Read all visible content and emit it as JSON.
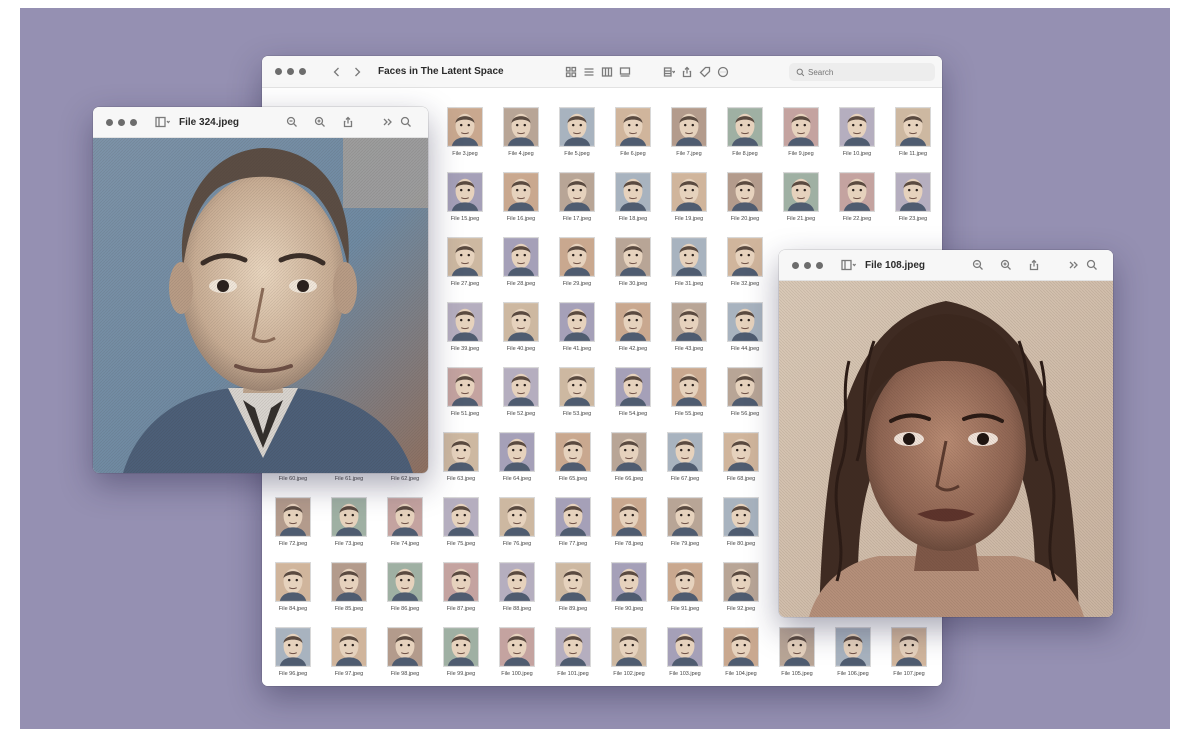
{
  "finder": {
    "title": "Faces in The Latent Space",
    "search_placeholder": "Search",
    "files": [
      "File 3.jpeg",
      "File 4.jpeg",
      "File 5.jpeg",
      "File 6.jpeg",
      "File 7.jpeg",
      "File 8.jpeg",
      "File 9.jpeg",
      "File 10.jpeg",
      "File 11.jpeg",
      "File 15.jpeg",
      "File 16.jpeg",
      "File 17.jpeg",
      "File 18.jpeg",
      "File 19.jpeg",
      "File 20.jpeg",
      "File 21.jpeg",
      "File 22.jpeg",
      "File 23.jpeg",
      "File 27.jpeg",
      "File 28.jpeg",
      "File 29.jpeg",
      "File 30.jpeg",
      "File 31.jpeg",
      "File 32.jpeg",
      "",
      "",
      "",
      "File 39.jpeg",
      "File 40.jpeg",
      "File 41.jpeg",
      "File 42.jpeg",
      "File 43.jpeg",
      "File 44.jpeg",
      "",
      "",
      "",
      "File 51.jpeg",
      "File 52.jpeg",
      "File 53.jpeg",
      "File 54.jpeg",
      "File 55.jpeg",
      "File 56.jpeg",
      "",
      "",
      "",
      "File 60.jpeg",
      "File 61.jpeg",
      "File 62.jpeg",
      "File 63.jpeg",
      "File 64.jpeg",
      "File 65.jpeg",
      "File 66.jpeg",
      "File 67.jpeg",
      "File 68.jpeg",
      "File 72.jpeg",
      "File 73.jpeg",
      "File 74.jpeg",
      "File 75.jpeg",
      "File 76.jpeg",
      "File 77.jpeg",
      "File 78.jpeg",
      "File 79.jpeg",
      "File 80.jpeg",
      "File 84.jpeg",
      "File 85.jpeg",
      "File 86.jpeg",
      "File 87.jpeg",
      "File 88.jpeg",
      "File 89.jpeg",
      "File 90.jpeg",
      "File 91.jpeg",
      "File 92.jpeg",
      "File 96.jpeg",
      "File 97.jpeg",
      "File 98.jpeg",
      "File 99.jpeg",
      "File 100.jpeg",
      "File 101.jpeg",
      "File 102.jpeg",
      "File 103.jpeg",
      "File 104.jpeg",
      "File 105.jpeg",
      "File 106.jpeg",
      "File 107.jpeg"
    ],
    "toolbar_icons": [
      "back-icon",
      "forward-icon",
      "grid-view-icon",
      "list-view-icon",
      "column-view-icon",
      "gallery-view-icon",
      "group-icon",
      "share-icon",
      "tag-icon",
      "more-icon",
      "search-icon"
    ]
  },
  "preview_left": {
    "title": "File 324.jpeg",
    "icons": [
      "sidebar-icon",
      "zoom-out-icon",
      "zoom-in-icon",
      "share-icon",
      "more-icon",
      "search-icon"
    ]
  },
  "preview_right": {
    "title": "File 108.jpeg",
    "icons": [
      "sidebar-icon",
      "zoom-out-icon",
      "zoom-in-icon",
      "share-icon",
      "more-icon",
      "search-icon"
    ]
  },
  "colors": {
    "desktop": "#9590b2",
    "window": "#ffffff",
    "titlebar": "#f7f7f7"
  }
}
